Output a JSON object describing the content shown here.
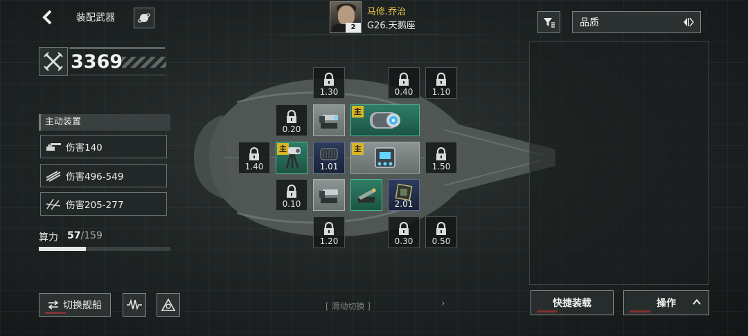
{
  "header": {
    "title": "装配武器",
    "commander": {
      "name": "马修.乔治",
      "level": "2"
    },
    "ship_name": "G26.天鹅座"
  },
  "power": {
    "value": "3369"
  },
  "devices": {
    "title": "主动装置",
    "items": [
      {
        "label": "伤害140"
      },
      {
        "label": "伤害496-549"
      },
      {
        "label": "伤害205-277"
      }
    ]
  },
  "compute": {
    "label": "算力",
    "current": "57",
    "max": "/159",
    "fraction": 0.358
  },
  "slots": {
    "main_tag": "主",
    "top": [
      "1.30",
      "0.40",
      "1.10"
    ],
    "row1_left": "0.20",
    "row2_left": "1.40",
    "row2_mid": "1.01",
    "row2_right": "1.50",
    "row3_left": "0.10",
    "row3_right": "2.01",
    "bottom": [
      "1.20",
      "0.30",
      "0.50"
    ]
  },
  "bottom_bar": {
    "switch_ship_label": "切换舰船",
    "swipe_hint": "[ 滑动切换 ]",
    "swipe_arrow": "›"
  },
  "right_panel": {
    "sort_label": "品质",
    "quick_equip_label": "快捷装载",
    "operate_label": "操作"
  }
}
